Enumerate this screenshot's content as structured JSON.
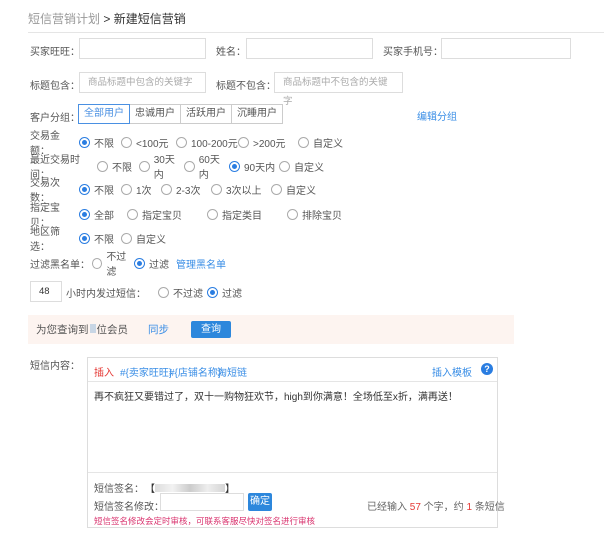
{
  "breadcrumb": {
    "parent": "短信营销计划",
    "separator": " > ",
    "current": "新建短信营销"
  },
  "fields": {
    "buyer_wangwang": "买家旺旺：",
    "name": "姓名：",
    "buyer_phone": "买家手机号：",
    "title_include": "标题包含：",
    "title_include_ph": "商品标题中包含的关键字",
    "title_exclude": "标题不包含：",
    "title_exclude_ph": "商品标题中不包含的关键字"
  },
  "groups": {
    "label": "客户分组：",
    "tabs": [
      "全部用户",
      "忠诚用户",
      "活跃用户",
      "沉睡用户"
    ],
    "active": 0,
    "edit": "编辑分组"
  },
  "filters": [
    {
      "label": "交易金额：",
      "options": [
        "不限",
        "<100元",
        "100-200元",
        ">200元",
        "自定义"
      ],
      "selected": 0
    },
    {
      "label": "最近交易时间：",
      "options": [
        "不限",
        "30天内",
        "60天内",
        "90天内",
        "自定义"
      ],
      "selected": 3
    },
    {
      "label": "交易次数：",
      "options": [
        "不限",
        "1次",
        "2-3次",
        "3次以上",
        "自定义"
      ],
      "selected": 0
    },
    {
      "label": "指定宝贝：",
      "options": [
        "全部",
        "指定宝贝",
        "指定类目",
        "排除宝贝"
      ],
      "selected": 0
    },
    {
      "label": "地区筛选：",
      "options": [
        "不限",
        "自定义"
      ],
      "selected": 0
    },
    {
      "label": "过滤黑名单：",
      "options": [
        "不过滤",
        "过滤"
      ],
      "selected": 1
    }
  ],
  "blacklist_link": "管理黑名单",
  "hours": {
    "value": "48",
    "label": "小时内发过短信：",
    "options": [
      "不过滤",
      "过滤"
    ],
    "selected": 1
  },
  "query": {
    "prefix": "为您查询到",
    "suffix": "位会员",
    "sync": "同步",
    "button": "查询"
  },
  "sms": {
    "label": "短信内容：",
    "insert": "插入",
    "tags": [
      "#{卖家旺旺}",
      "#{店铺名称}",
      "淘短链"
    ],
    "template": "插入模板",
    "help": "?",
    "content": "再不疯狂又要错过了，双十一购物狂欢节，high到你满意！全场低至x折，满再送！",
    "sign_label": "短信签名：",
    "sign_mod_label": "短信签名修改：",
    "confirm": "确定",
    "count_prefix": "已经输入",
    "count": "57",
    "count_mid": "个字，约",
    "msgs": "1",
    "count_suffix": "条短信",
    "notice": "短信签名修改会定时审核，可联系客服尽快对签名进行审核"
  }
}
